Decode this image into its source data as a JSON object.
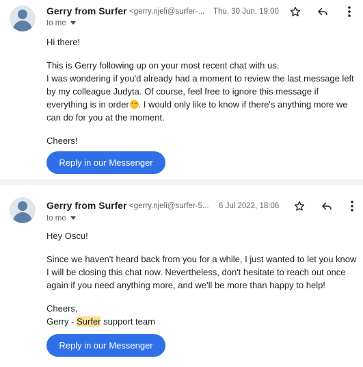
{
  "messages": [
    {
      "sender_name": "Gerry from Surfer",
      "sender_email": "<gerry.njeli@surfer-...",
      "date": "Thu, 30 Jun, 19:00",
      "to": "to me",
      "greeting": "Hi there!",
      "para1_line1": "This is Gerry following up on your most recent chat with us.",
      "para1_rest_a": "I was wondering if you'd already had a moment to review the last message left by my colleague Judyta. Of course, feel free to ignore this message if everything is in order",
      "para1_rest_b": ". I would only like to know if there's anything more we can do for you at the moment.",
      "signoff": "Cheers!",
      "cta_label": "Reply in our Messenger"
    },
    {
      "sender_name": "Gerry from Surfer",
      "sender_email": "<gerry.njeli@surfer-5...",
      "date": "6 Jul 2022, 18:06",
      "to": "to me",
      "greeting": "Hey Oscu!",
      "paragraph": "Since we haven't heard back from you for a while, I just wanted to let you know I will be closing this chat now. Nevertheless, don't hesitate to reach out once again if you need anything more, and we'll be more than happy to help!",
      "signoff_1": "Cheers,",
      "signoff_2_prefix": "Gerry - ",
      "signoff_2_highlight": "Surfer",
      "signoff_2_suffix": " support team",
      "cta_label": "Reply in our Messenger"
    }
  ],
  "icons": [
    "star-icon",
    "reply-icon",
    "more-vert-icon",
    "avatar-icon",
    "smile-emoji-icon",
    "chevron-down-icon"
  ],
  "colors": {
    "cta_blue": "#2f6fe8",
    "highlight": "#fde293",
    "avatar_bg": "#dfe5ec",
    "avatar_fg": "#5f7fa6"
  }
}
